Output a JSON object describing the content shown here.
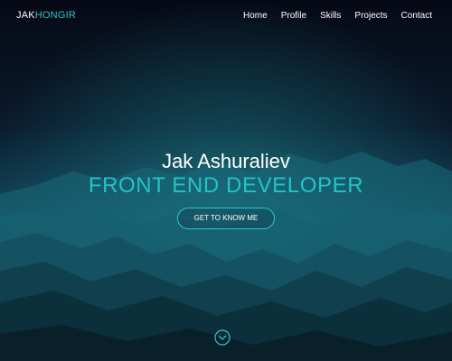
{
  "brand": {
    "name_primary": "JAK",
    "name_accent": "HONGIR"
  },
  "nav": {
    "items": [
      {
        "label": "Home"
      },
      {
        "label": "Profile"
      },
      {
        "label": "Skills"
      },
      {
        "label": "Projects"
      },
      {
        "label": "Contact"
      }
    ]
  },
  "hero": {
    "name": "Jak Ashuraliev",
    "role": "FRONT END DEVELOPER",
    "cta_label": "GET TO KNOW ME",
    "scroll_icon": "chevron-down-circle-icon"
  },
  "colors": {
    "accent": "#23c3c6",
    "background": "#070b17"
  }
}
